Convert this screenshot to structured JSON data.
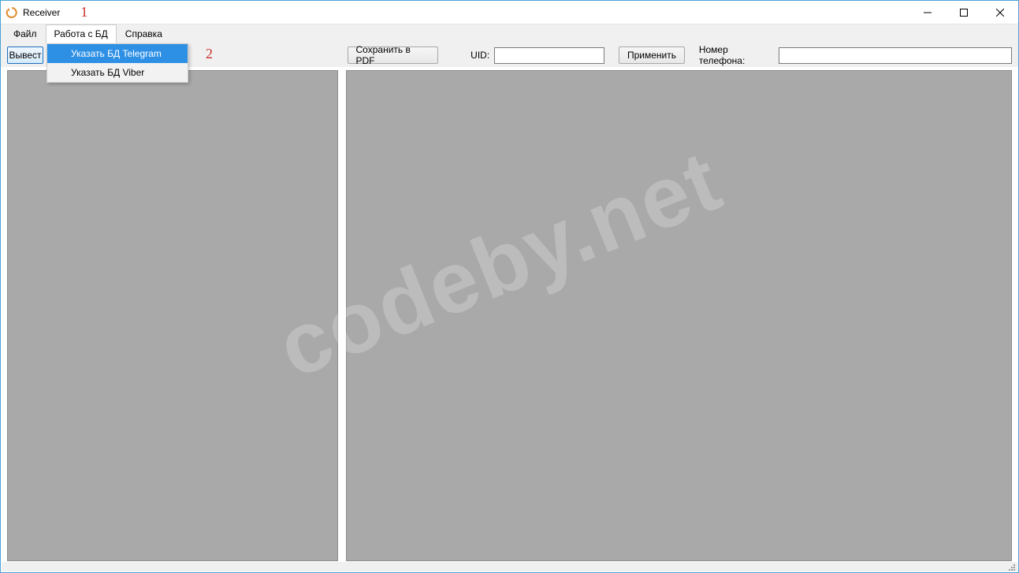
{
  "window": {
    "title": "Receiver"
  },
  "annotations": {
    "one": "1",
    "two": "2"
  },
  "menubar": {
    "file": "Файл",
    "db": "Работа с БД",
    "help": "Справка"
  },
  "dropdown": {
    "items": [
      {
        "label": "Указать БД Telegram"
      },
      {
        "label": "Указать БД Viber"
      }
    ]
  },
  "toolbar": {
    "output_button_partial": "Вывест",
    "save_pdf": "Сохранить в PDF",
    "uid_label": "UID:",
    "uid_value": "",
    "apply": "Применить",
    "phone_label": "Номер телефона:",
    "phone_value": ""
  },
  "watermark": "codeby.net"
}
